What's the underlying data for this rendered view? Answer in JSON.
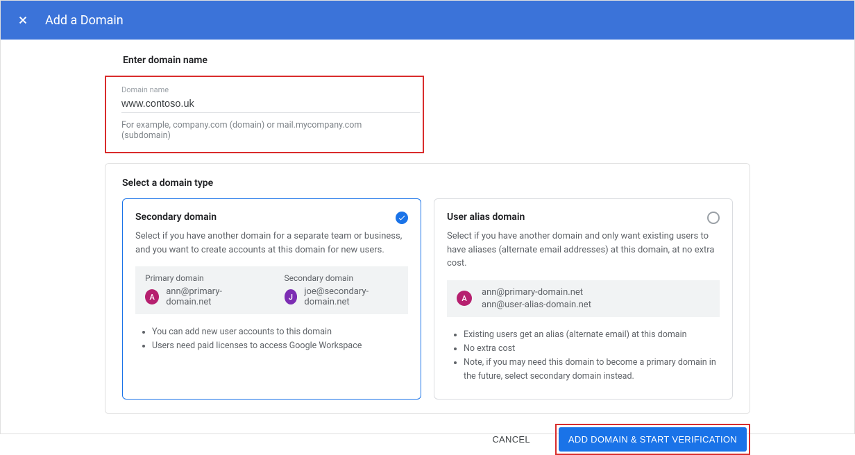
{
  "header": {
    "title": "Add a Domain"
  },
  "enterSection": {
    "title": "Enter domain name",
    "fieldLabel": "Domain name",
    "value": "www.contoso.uk",
    "helper": "For example, company.com (domain) or mail.mycompany.com (subdomain)"
  },
  "typeSection": {
    "title": "Select a domain type",
    "secondary": {
      "title": "Secondary domain",
      "desc": "Select if you have another domain for a separate team or business, and you want to create accounts at this domain for new users.",
      "example": {
        "primaryLabel": "Primary domain",
        "primaryEmail": "ann@primary-domain.net",
        "primaryInitial": "A",
        "secondaryLabel": "Secondary domain",
        "secondaryEmail": "joe@secondary-domain.net",
        "secondaryInitial": "J"
      },
      "bullets": [
        "You can add new user accounts to this domain",
        "Users need paid licenses to access Google Workspace"
      ]
    },
    "alias": {
      "title": "User alias domain",
      "desc": "Select if you have another domain and only want existing users to have aliases (alternate email addresses) at this domain, at no extra cost.",
      "example": {
        "initial": "A",
        "email1": "ann@primary-domain.net",
        "email2": "ann@user-alias-domain.net"
      },
      "bullets": [
        "Existing users get an alias (alternate email) at this domain",
        "No extra cost",
        "Note, if you may need this domain to become a primary domain in the future, select secondary domain instead."
      ]
    }
  },
  "footer": {
    "cancel": "CANCEL",
    "submit": "ADD DOMAIN & START VERIFICATION"
  }
}
